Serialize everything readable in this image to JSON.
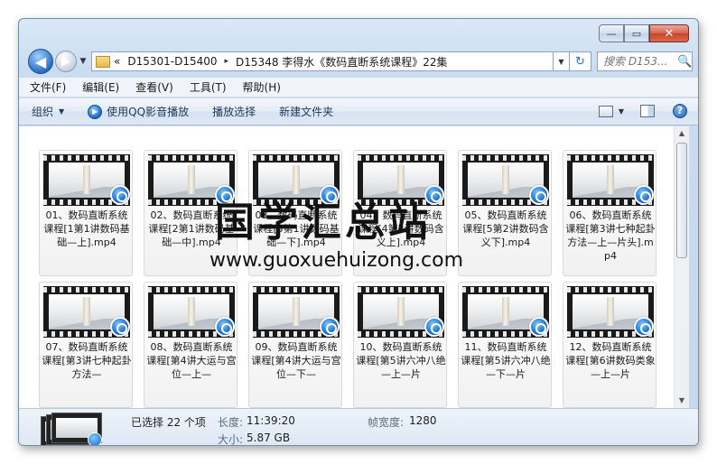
{
  "window": {
    "controls": {
      "minimize": "—",
      "maximize": "▭",
      "close": "✕"
    }
  },
  "nav": {
    "back_icon": "◀",
    "forward_icon": "▶",
    "dropdown_icon": "▼",
    "breadcrumb_overflow": "«",
    "crumbs": [
      "D15301-D15400",
      "D15348 李得水《数码直断系统课程》22集"
    ],
    "separator": "▸",
    "refresh_icon": "↻",
    "search_placeholder": "搜索 D153...",
    "search_icon": "🔍"
  },
  "menu": [
    "文件(F)",
    "编辑(E)",
    "查看(V)",
    "工具(T)",
    "帮助(H)"
  ],
  "commands": {
    "organize": "组织",
    "play_qq": "使用QQ影音播放",
    "play_select": "播放选择",
    "new_folder": "新建文件夹",
    "help_icon": "?"
  },
  "files": [
    "01、数码直断系统课程[1第1讲数码基础—上].mp4",
    "02、数码直断系统课程[2第1讲数码基础—中].mp4",
    "03、数码直断系统课程[3第1讲数码基础—下].mp4",
    "04、数码直断系统课程[4第2讲数码含义上].mp4",
    "05、数码直断系统课程[5第2讲数码含义下].mp4",
    "06、数码直断系统课程[第3讲七种起卦方法—上—片头].mp4",
    "07、数码直断系统课程[第3讲七种起卦方法—",
    "08、数码直断系统课程[第4讲大运与宫位—上—",
    "09、数码直断系统课程[第4讲大运与宫位—下—",
    "10、数码直断系统课程[第5讲六冲八绝—上—片",
    "11、数码直断系统课程[第5讲六冲八绝—下—片",
    "12、数码直断系统课程[第6讲数码类象—上—片"
  ],
  "details": {
    "selected": "已选择 22 个项",
    "length_label": "长度:",
    "length_value": "11:39:20",
    "size_label": "大小:",
    "size_value": "5.87 GB",
    "width_label": "帧宽度:",
    "width_value": "1280"
  },
  "watermark": {
    "cn": "国学汇总站",
    "url": "www.guoxuehuizong.com"
  }
}
